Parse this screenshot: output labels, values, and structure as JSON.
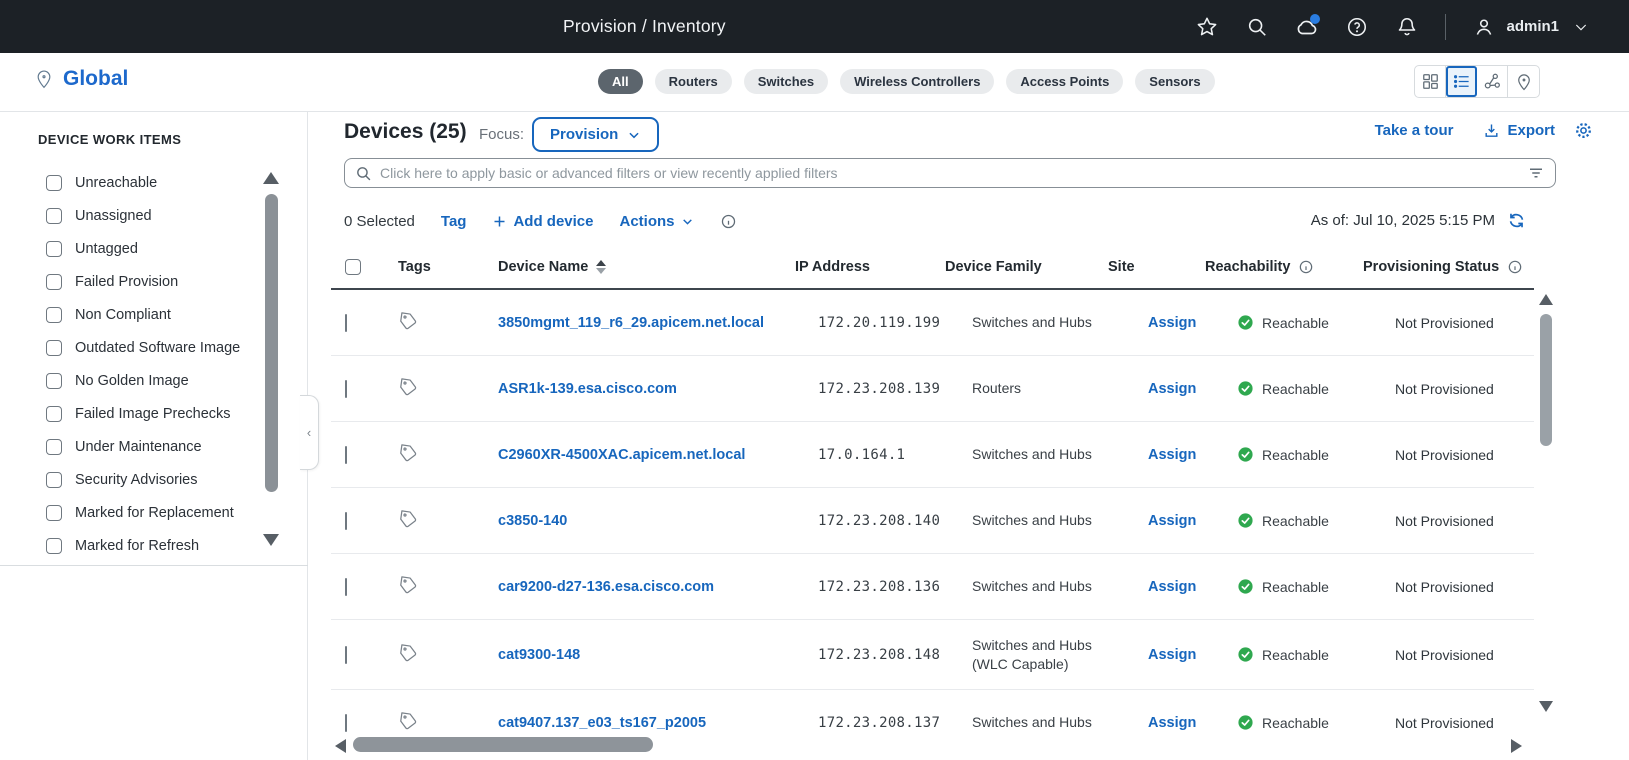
{
  "colors": {
    "accent": "#1766bd",
    "success": "#2fa84f",
    "topbar_bg": "#1c2126",
    "chip_selected": "#5c656d"
  },
  "topbar": {
    "breadcrumb": "Provision / Inventory",
    "username": "admin1"
  },
  "subheader": {
    "location": "Global",
    "filters": [
      {
        "label": "All",
        "selected": true
      },
      {
        "label": "Routers",
        "selected": false
      },
      {
        "label": "Switches",
        "selected": false
      },
      {
        "label": "Wireless Controllers",
        "selected": false
      },
      {
        "label": "Access Points",
        "selected": false
      },
      {
        "label": "Sensors",
        "selected": false
      }
    ]
  },
  "sidebar": {
    "title": "DEVICE WORK ITEMS",
    "items": [
      {
        "label": "Unreachable"
      },
      {
        "label": "Unassigned"
      },
      {
        "label": "Untagged"
      },
      {
        "label": "Failed Provision"
      },
      {
        "label": "Non Compliant"
      },
      {
        "label": "Outdated Software Image"
      },
      {
        "label": "No Golden Image"
      },
      {
        "label": "Failed Image Prechecks"
      },
      {
        "label": "Under Maintenance"
      },
      {
        "label": "Security Advisories"
      },
      {
        "label": "Marked for Replacement"
      },
      {
        "label": "Marked for Refresh"
      }
    ]
  },
  "page_header": {
    "title": "Devices (25)",
    "focus_label": "Focus:",
    "focus_value": "Provision",
    "tour": "Take a tour",
    "export": "Export"
  },
  "filter_bar": {
    "placeholder": "Click here to apply basic or advanced filters or view recently applied filters"
  },
  "toolbar": {
    "selected": "0 Selected",
    "tag": "Tag",
    "add_device": "Add device",
    "actions": "Actions",
    "as_of": "As of: Jul 10, 2025 5:15 PM"
  },
  "table": {
    "columns": {
      "tags": "Tags",
      "name": "Device Name",
      "ip": "IP Address",
      "family": "Device Family",
      "site": "Site",
      "reachability": "Reachability",
      "provisioning": "Provisioning Status"
    },
    "rows": [
      {
        "name": "3850mgmt_119_r6_29.apicem.net.local",
        "ip": "172.20.119.199",
        "family": "Switches and Hubs",
        "site_action": "Assign",
        "reachability": "Reachable",
        "provisioning": "Not Provisioned"
      },
      {
        "name": "ASR1k-139.esa.cisco.com",
        "ip": "172.23.208.139",
        "family": "Routers",
        "site_action": "Assign",
        "reachability": "Reachable",
        "provisioning": "Not Provisioned"
      },
      {
        "name": "C2960XR-4500XAC.apicem.net.local",
        "ip": "17.0.164.1",
        "family": "Switches and Hubs",
        "site_action": "Assign",
        "reachability": "Reachable",
        "provisioning": "Not Provisioned"
      },
      {
        "name": "c3850-140",
        "ip": "172.23.208.140",
        "family": "Switches and Hubs",
        "site_action": "Assign",
        "reachability": "Reachable",
        "provisioning": "Not Provisioned"
      },
      {
        "name": "car9200-d27-136.esa.cisco.com",
        "ip": "172.23.208.136",
        "family": "Switches and Hubs",
        "site_action": "Assign",
        "reachability": "Reachable",
        "provisioning": "Not Provisioned"
      },
      {
        "name": "cat9300-148",
        "ip": "172.23.208.148",
        "family": "Switches and Hubs (WLC Capable)",
        "site_action": "Assign",
        "reachability": "Reachable",
        "provisioning": "Not Provisioned",
        "tall": true
      },
      {
        "name": "cat9407.137_e03_ts167_p2005",
        "ip": "172.23.208.137",
        "family": "Switches and Hubs",
        "site_action": "Assign",
        "reachability": "Reachable",
        "provisioning": "Not Provisioned"
      }
    ]
  }
}
